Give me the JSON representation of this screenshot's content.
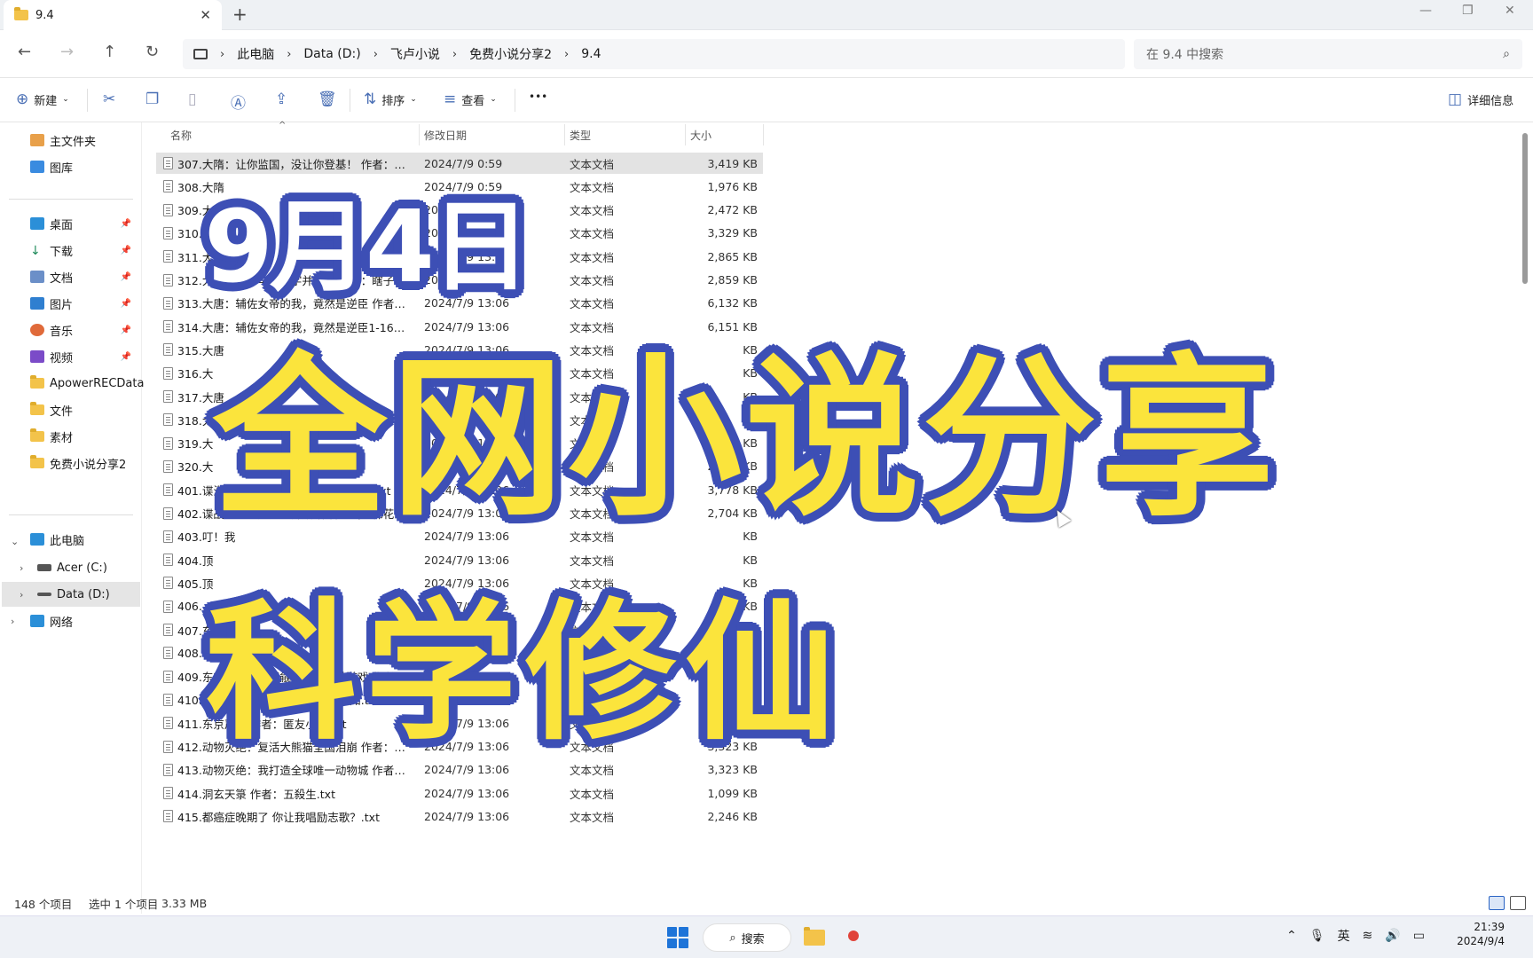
{
  "window": {
    "tab_title": "9.4",
    "new_tab": "+",
    "minimize": "—",
    "restore": "❐",
    "close": "✕",
    "tab_close": "✕"
  },
  "nav": {
    "back": "←",
    "forward": "→",
    "up": "↑",
    "refresh": "↻"
  },
  "breadcrumb": [
    "此电脑",
    "Data (D:)",
    "飞卢小说",
    "免费小说分享2",
    "9.4"
  ],
  "search": {
    "placeholder": "在 9.4 中搜索"
  },
  "toolbar": {
    "new": "新建",
    "sort": "排序",
    "view": "查看",
    "more": "•••",
    "details": "详细信息"
  },
  "sidebar": {
    "home": "主文件夹",
    "gallery": "图库",
    "desktop": "桌面",
    "downloads": "下载",
    "documents": "文档",
    "pictures": "图片",
    "music": "音乐",
    "videos": "视频",
    "f1": "ApowerRECData",
    "f2": "文件",
    "f3": "素材",
    "f4": "免费小说分享2",
    "thispc": "此电脑",
    "drive_c": "Acer (C:)",
    "drive_d": "Data (D:)",
    "network": "网络"
  },
  "columns": {
    "name": "名称",
    "date": "修改日期",
    "type": "类型",
    "size": "大小"
  },
  "files": [
    {
      "name": "307.大隋：让你监国，没让你登基！ 作者：皮...",
      "date": "2024/7/9 0:59",
      "type": "文本文档",
      "size": "3,419 KB"
    },
    {
      "name": "308.大隋",
      "date": "2024/7/9 0:59",
      "type": "文本文档",
      "size": "1,976 KB"
    },
    {
      "name": "309.大",
      "date": "2024/7/9 0:59",
      "type": "文本文档",
      "size": "2,472 KB"
    },
    {
      "name": "310.大唐",
      "date": "2024/7/9 13:06",
      "type": "文本文档",
      "size": "3,329 KB"
    },
    {
      "name": "311.大唐：从",
      "date": "2024/7/9 13:06",
      "type": "文本文档",
      "size": "2,865 KB"
    },
    {
      "name": "312.大唐：从小卒到一字并肩王 作者：瞎子爱...",
      "date": "2024/7/9 13:06",
      "type": "文本文档",
      "size": "2,859 KB"
    },
    {
      "name": "313.大唐：辅佐女帝的我，竟然是逆臣 作者：...",
      "date": "2024/7/9 13:06",
      "type": "文本文档",
      "size": "6,132 KB"
    },
    {
      "name": "314.大唐：辅佐女帝的我，竟然是逆臣1-1635...",
      "date": "2024/7/9 13:06",
      "type": "文本文档",
      "size": "6,151 KB"
    },
    {
      "name": "315.大唐",
      "date": "2024/7/9 13:06",
      "type": "文本文档",
      "size": "KB"
    },
    {
      "name": "316.大",
      "date": "2024/7/9 13:06",
      "type": "文本文档",
      "size": "KB"
    },
    {
      "name": "317.大唐",
      "date": "2024/7/9 13:06",
      "type": "文本文档",
      "size": "KB"
    },
    {
      "name": "318.大唐",
      "date": "2024/7/9 13:06",
      "type": "文本文档",
      "size": "KB"
    },
    {
      "name": "319.大",
      "date": "2024/7/9 13:06",
      "type": "文本文档",
      "size": "2, KB"
    },
    {
      "name": "320.大",
      "date": "2024/7/9 13:06",
      "type": "文本文档",
      "size": "2,678 KB"
    },
    {
      "name": "401.谍海风云之多面特工 作者：乱劈柴.txt",
      "date": "2024/7/9 13:06",
      "type": "文本文档",
      "size": "3,778 KB"
    },
    {
      "name": "402.谍战：从悬崖之上开始 作者：我吃棉花糖.t...",
      "date": "2024/7/9 13:06",
      "type": "文本文档",
      "size": "2,704 KB"
    },
    {
      "name": "403.叮！我",
      "date": "2024/7/9 13:06",
      "type": "文本文档",
      "size": "KB"
    },
    {
      "name": "404.顶",
      "date": "2024/7/9 13:06",
      "type": "文本文档",
      "size": "KB"
    },
    {
      "name": "405.顶",
      "date": "2024/7/9 13:06",
      "type": "文本文档",
      "size": "KB"
    },
    {
      "name": "406.",
      "date": "2024/7/9 13:06",
      "type": "文本文档",
      "size": "KB"
    },
    {
      "name": "407.东",
      "date": "2024/7/9 13:06",
      "type": "文本文档",
      "size": "KB"
    },
    {
      "name": "408.",
      "date": "2024/7/9 13:06",
      "type": "文本文档",
      "size": "KB"
    },
    {
      "name": "409.东京：被太太觊觎的我只想做游戏 作者：...",
      "date": "2024/7/9 13:06",
      "type": "文本文档",
      "size": "KB"
    },
    {
      "name": "410.东京：我的百鬼绘卷 作者：苍知.txt",
      "date": "2024/7/9 13:06",
      "type": "文本文档",
      "size": "2,838 KB"
    },
    {
      "name": "411.东京声士 作者：匿友小尘.txt",
      "date": "2024/7/9 13:06",
      "type": "文本文档",
      "size": "6,860 KB"
    },
    {
      "name": "412.动物灭绝：复活大熊猫全国泪崩 作者：鹤...",
      "date": "2024/7/9 13:06",
      "type": "文本文档",
      "size": "3,323 KB"
    },
    {
      "name": "413.动物灭绝：我打造全球唯一动物城 作者：...",
      "date": "2024/7/9 13:06",
      "type": "文本文档",
      "size": "3,323 KB"
    },
    {
      "name": "414.洞玄天箓 作者：五殺生.txt",
      "date": "2024/7/9 13:06",
      "type": "文本文档",
      "size": "1,099 KB"
    },
    {
      "name": "415.都癌症晚期了 你让我唱励志歌？.txt",
      "date": "2024/7/9 13:06",
      "type": "文本文档",
      "size": "2,246 KB"
    }
  ],
  "status": {
    "count": "148 个项目",
    "selected": "选中 1 个项目",
    "size": "3.33 MB"
  },
  "taskbar": {
    "search": "搜索",
    "lang": "英",
    "time": "21:39",
    "date": "2024/9/4"
  },
  "overlay": {
    "date": "9月4日",
    "title": "全网小说分享",
    "subtitle": "科学修仙"
  },
  "colors": {
    "accent": "#3d4fb5",
    "highlight": "#fbe43c"
  }
}
